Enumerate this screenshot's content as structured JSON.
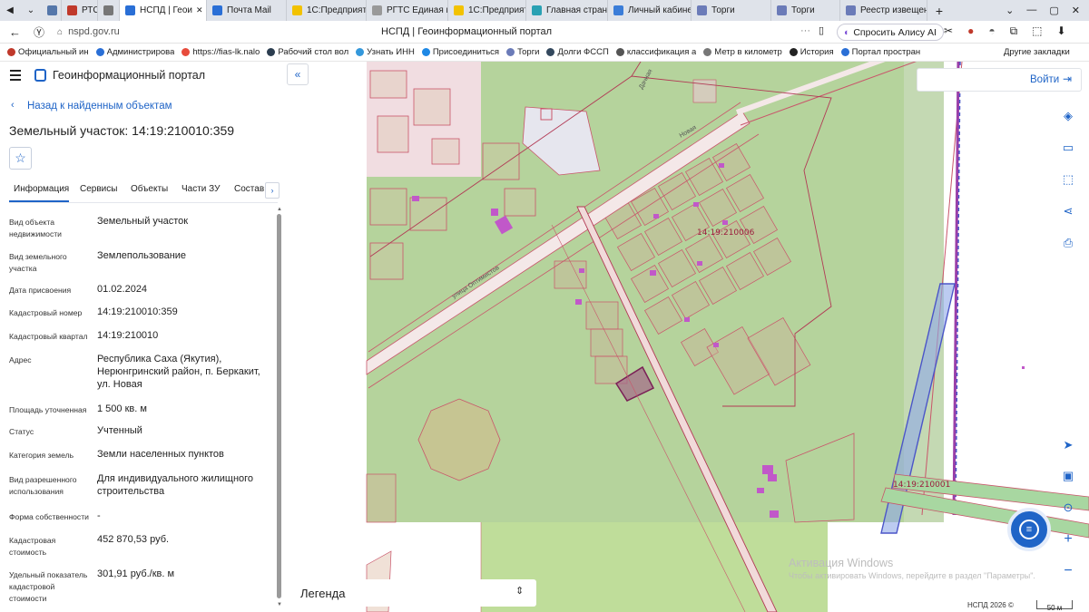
{
  "browser": {
    "tabs": [
      {
        "label": "",
        "color": "#5577aa"
      },
      {
        "label": "РТС",
        "color": "#c0392b"
      },
      {
        "label": "",
        "color": "#777"
      },
      {
        "label": "НСПД | Геои",
        "color": "#2a6fd6"
      },
      {
        "label": "Почта Mail",
        "color": "#2a6fd6"
      },
      {
        "label": "1С:Предприяти",
        "color": "#f2c200"
      },
      {
        "label": "РГТС Единая гео",
        "color": "#999"
      },
      {
        "label": "1С:Предприяти",
        "color": "#f2c200"
      },
      {
        "label": "Главная страниц",
        "color": "#2aa1b3"
      },
      {
        "label": "Личный кабинет",
        "color": "#3b7dd8"
      },
      {
        "label": "Торги",
        "color": "#6b7bb8"
      },
      {
        "label": "Торги",
        "color": "#6b7bb8"
      },
      {
        "label": "Реестр извещен",
        "color": "#6b7bb8"
      }
    ],
    "address": "nspd.gov.ru",
    "page_title": "НСПД | Геоинформационный портал",
    "alice_label": "Спросить Алису AI",
    "bookmarks": [
      "Официальный ин",
      "Администрирова",
      "https://fias-lk.nalo",
      "Рабочий стол вол",
      "Узнать ИНН",
      "Присоединиться",
      "Торги",
      "Долги ФССП",
      "классификация а",
      "Метр в километр",
      "История",
      "Портал простран"
    ],
    "bookmark_colors": [
      "#c0392b",
      "#2a6fd6",
      "#e74c3c",
      "#2c3e50",
      "#3498db",
      "#1e88e5",
      "#6b7bb8",
      "#34495e",
      "#555",
      "#777",
      "#222",
      "#2a6fd6"
    ],
    "other_bookmarks": "Другие закладки"
  },
  "portal": {
    "title": "Геоинформационный портал",
    "back_link": "Назад к найденным объектам",
    "object_title": "Земельный участок: 14:19:210010:359"
  },
  "tabs": [
    "Информация",
    "Сервисы",
    "Объекты",
    "Части ЗУ",
    "Состав"
  ],
  "info": [
    {
      "label": "Вид объекта недвижимости",
      "value": "Земельный участок"
    },
    {
      "label": "Вид земельного участка",
      "value": "Землепользование"
    },
    {
      "label": "Дата присвоения",
      "value": "01.02.2024"
    },
    {
      "label": "Кадастровый номер",
      "value": "14:19:210010:359"
    },
    {
      "label": "Кадастровый квартал",
      "value": "14:19:210010"
    },
    {
      "label": "Адрес",
      "value": "Республика Саха (Якутия), Нерюнгринский район, п. Беркакит, ул. Новая"
    },
    {
      "label": "Площадь уточненная",
      "value": "1 500 кв. м"
    },
    {
      "label": "Статус",
      "value": "Учтенный"
    },
    {
      "label": "Категория земель",
      "value": "Земли населенных пунктов"
    },
    {
      "label": "Вид разрешенного использования",
      "value": "Для индивидуального жилищного строительства"
    },
    {
      "label": "Форма собственности",
      "value": "-"
    },
    {
      "label": "Кадастровая стоимость",
      "value": "452 870,53 руб."
    },
    {
      "label": "Удельный показатель кадастровой стоимости",
      "value": "301,91 руб./кв. м"
    }
  ],
  "map": {
    "login": "Войти",
    "legend": "Легенда",
    "quarter_label_1": "14:19:210006",
    "quarter_label_2": "14:19:210001",
    "street_label": "улица Оптимистов",
    "street_label_2": "Новая",
    "street_label_3": "Дачная",
    "attribution": "НСПД 2026 ©",
    "scale": "50 м",
    "windows_title": "Активация Windows",
    "windows_sub": "Чтобы активировать Windows, перейдите в раздел \"Параметры\"."
  }
}
